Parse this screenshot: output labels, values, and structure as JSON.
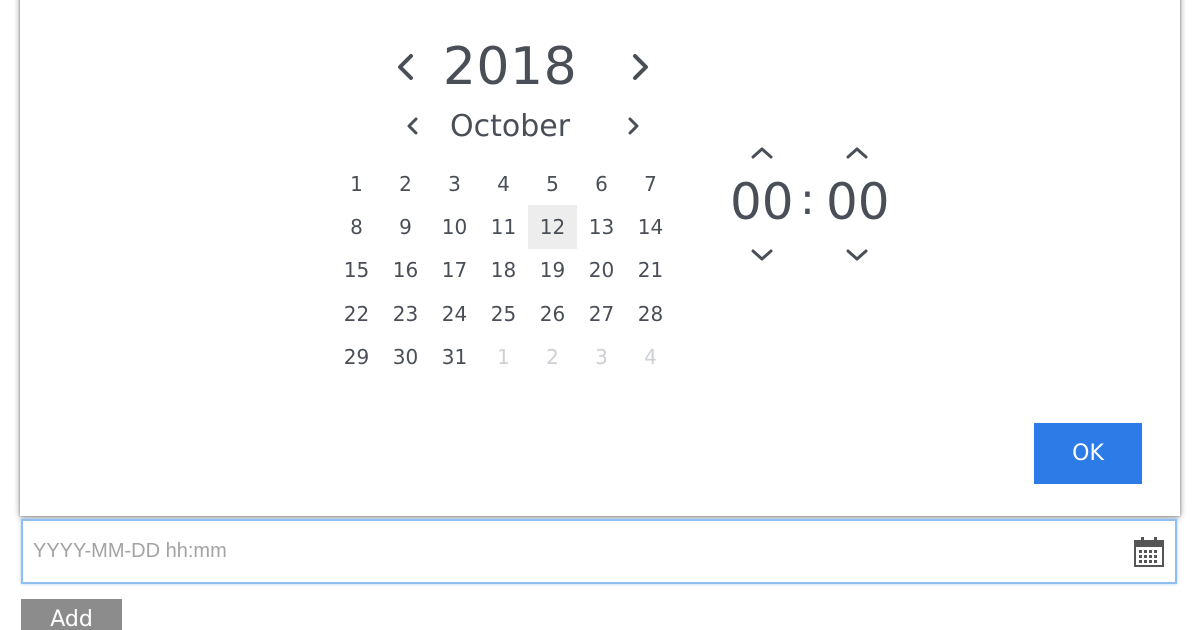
{
  "picker": {
    "year": "2018",
    "month": "October",
    "days": [
      {
        "label": "1",
        "other": false,
        "today": false
      },
      {
        "label": "2",
        "other": false,
        "today": false
      },
      {
        "label": "3",
        "other": false,
        "today": false
      },
      {
        "label": "4",
        "other": false,
        "today": false
      },
      {
        "label": "5",
        "other": false,
        "today": false
      },
      {
        "label": "6",
        "other": false,
        "today": false
      },
      {
        "label": "7",
        "other": false,
        "today": false
      },
      {
        "label": "8",
        "other": false,
        "today": false
      },
      {
        "label": "9",
        "other": false,
        "today": false
      },
      {
        "label": "10",
        "other": false,
        "today": false
      },
      {
        "label": "11",
        "other": false,
        "today": false
      },
      {
        "label": "12",
        "other": false,
        "today": true
      },
      {
        "label": "13",
        "other": false,
        "today": false
      },
      {
        "label": "14",
        "other": false,
        "today": false
      },
      {
        "label": "15",
        "other": false,
        "today": false
      },
      {
        "label": "16",
        "other": false,
        "today": false
      },
      {
        "label": "17",
        "other": false,
        "today": false
      },
      {
        "label": "18",
        "other": false,
        "today": false
      },
      {
        "label": "19",
        "other": false,
        "today": false
      },
      {
        "label": "20",
        "other": false,
        "today": false
      },
      {
        "label": "21",
        "other": false,
        "today": false
      },
      {
        "label": "22",
        "other": false,
        "today": false
      },
      {
        "label": "23",
        "other": false,
        "today": false
      },
      {
        "label": "24",
        "other": false,
        "today": false
      },
      {
        "label": "25",
        "other": false,
        "today": false
      },
      {
        "label": "26",
        "other": false,
        "today": false
      },
      {
        "label": "27",
        "other": false,
        "today": false
      },
      {
        "label": "28",
        "other": false,
        "today": false
      },
      {
        "label": "29",
        "other": false,
        "today": false
      },
      {
        "label": "30",
        "other": false,
        "today": false
      },
      {
        "label": "31",
        "other": false,
        "today": false
      },
      {
        "label": "1",
        "other": true,
        "today": false
      },
      {
        "label": "2",
        "other": true,
        "today": false
      },
      {
        "label": "3",
        "other": true,
        "today": false
      },
      {
        "label": "4",
        "other": true,
        "today": false
      }
    ],
    "time": {
      "hour": "00",
      "separator": ":",
      "minute": "00"
    },
    "ok_label": "OK"
  },
  "form": {
    "input_value": "",
    "input_placeholder": "YYYY-MM-DD hh:mm",
    "add_label": "Add"
  },
  "colors": {
    "accent": "#2d7be6",
    "text": "#4a4f57",
    "muted_day": "#cdd0d4",
    "today_bg": "#ededed",
    "input_border": "#8fbef0",
    "add_button_bg": "#8c8c8c"
  },
  "icons": {
    "prev": "chevron-left-icon",
    "next": "chevron-right-icon",
    "up": "chevron-up-icon",
    "down": "chevron-down-icon",
    "calendar": "calendar-icon"
  }
}
